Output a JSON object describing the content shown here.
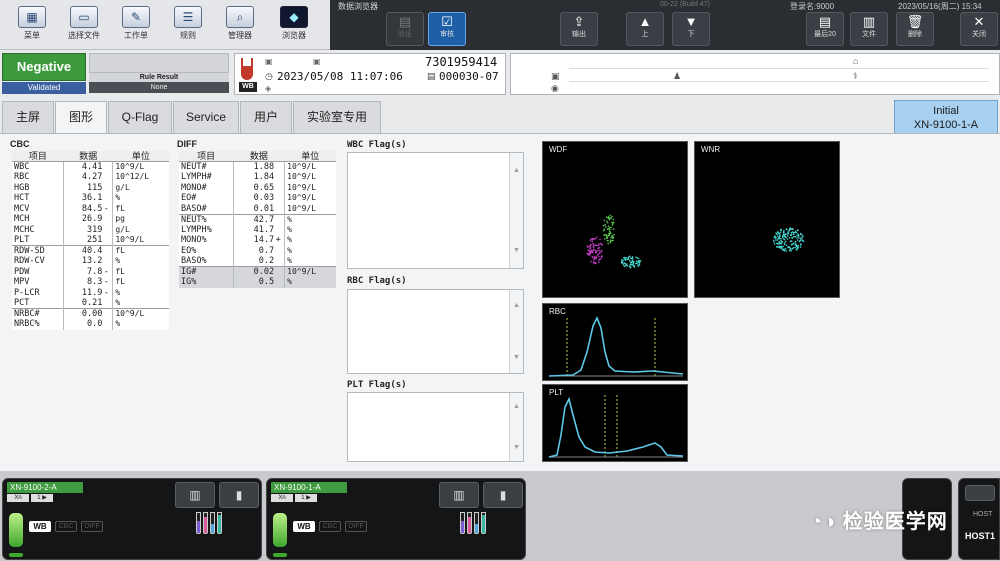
{
  "toolbar": {
    "left_buttons": [
      {
        "label": "菜单",
        "icon": "menu-icon"
      },
      {
        "label": "选择文件",
        "icon": "folder-icon"
      },
      {
        "label": "工作单",
        "icon": "worklist-icon"
      },
      {
        "label": "规则",
        "icon": "rules-icon"
      },
      {
        "label": "管理器",
        "icon": "manager-icon"
      },
      {
        "label": "浏览器",
        "icon": "browser-icon"
      }
    ],
    "window_title": "数据浏览器",
    "build": "00-22 (Build 47)",
    "login": "登录名:9000",
    "datetime": "2023/05/16(周二) 15:34",
    "right_buttons": [
      {
        "label": "验证",
        "icon": "validate-icon",
        "glyph": "▤"
      },
      {
        "label": "审核",
        "icon": "check-icon",
        "glyph": "☑"
      },
      {
        "label": "输出",
        "icon": "output-icon",
        "glyph": "⇪"
      },
      {
        "label": "上",
        "icon": "arrow-up-icon",
        "glyph": "▲"
      },
      {
        "label": "下",
        "icon": "arrow-down-icon",
        "glyph": "▼"
      },
      {
        "label": "最后20",
        "icon": "last20-icon",
        "glyph": "▤"
      },
      {
        "label": "文件",
        "icon": "file-icon",
        "glyph": "▥"
      },
      {
        "label": "删除",
        "icon": "delete-icon",
        "glyph": "🗑"
      },
      {
        "label": "关闭",
        "icon": "close-icon",
        "glyph": "✕"
      }
    ]
  },
  "status": {
    "result": "Negative",
    "validated": "Validated",
    "rule_result_label": "Rule Result",
    "rule_result_value": "None"
  },
  "sample": {
    "tube_label": "WB",
    "sample_no": "7301959414",
    "datetime": "2023/05/08 11:07:06",
    "seq": "000030-07"
  },
  "tabs": [
    {
      "label": "主屏",
      "active": false
    },
    {
      "label": "图形",
      "active": true
    },
    {
      "label": "Q-Flag",
      "active": false
    },
    {
      "label": "Service",
      "active": false
    },
    {
      "label": "用户",
      "active": false
    },
    {
      "label": "实验室专用",
      "active": false
    }
  ],
  "initial": {
    "line1": "Initial",
    "line2": "XN-9100-1-A"
  },
  "cbc": {
    "title": "CBC",
    "headers": [
      "项目",
      "数据",
      "单位"
    ],
    "rows": [
      {
        "item": "WBC",
        "value": "4.41",
        "flag": "",
        "unit": "10^9/L",
        "group": false
      },
      {
        "item": "RBC",
        "value": "4.27",
        "flag": "",
        "unit": "10^12/L",
        "group": false
      },
      {
        "item": "HGB",
        "value": "115",
        "flag": "",
        "unit": "g/L",
        "group": false
      },
      {
        "item": "HCT",
        "value": "36.1",
        "flag": "",
        "unit": "%",
        "group": false
      },
      {
        "item": "MCV",
        "value": "84.5",
        "flag": "-",
        "unit": "fL",
        "group": false
      },
      {
        "item": "MCH",
        "value": "26.9",
        "flag": "",
        "unit": "pg",
        "group": false
      },
      {
        "item": "MCHC",
        "value": "319",
        "flag": "",
        "unit": "g/L",
        "group": false
      },
      {
        "item": "PLT",
        "value": "251",
        "flag": "",
        "unit": "10^9/L",
        "group": false
      },
      {
        "item": "RDW-SD",
        "value": "40.4",
        "flag": "",
        "unit": "fL",
        "group": true
      },
      {
        "item": "RDW-CV",
        "value": "13.2",
        "flag": "",
        "unit": "%",
        "group": false
      },
      {
        "item": "PDW",
        "value": "7.8",
        "flag": "-",
        "unit": "fL",
        "group": false
      },
      {
        "item": "MPV",
        "value": "8.3",
        "flag": "-",
        "unit": "fL",
        "group": false
      },
      {
        "item": "P-LCR",
        "value": "11.9",
        "flag": "-",
        "unit": "%",
        "group": false
      },
      {
        "item": "PCT",
        "value": "0.21",
        "flag": "",
        "unit": "%",
        "group": false
      },
      {
        "item": "NRBC#",
        "value": "0.00",
        "flag": "",
        "unit": "10^9/L",
        "group": true
      },
      {
        "item": "NRBC%",
        "value": "0.0",
        "flag": "",
        "unit": "%",
        "group": false
      }
    ]
  },
  "diff": {
    "title": "DIFF",
    "headers": [
      "项目",
      "数据",
      "单位"
    ],
    "rows": [
      {
        "item": "NEUT#",
        "value": "1.88",
        "flag": "",
        "unit": "10^9/L",
        "group": false,
        "shade": false
      },
      {
        "item": "LYMPH#",
        "value": "1.84",
        "flag": "",
        "unit": "10^9/L",
        "group": false,
        "shade": false
      },
      {
        "item": "MONO#",
        "value": "0.65",
        "flag": "",
        "unit": "10^9/L",
        "group": false,
        "shade": false
      },
      {
        "item": "EO#",
        "value": "0.03",
        "flag": "",
        "unit": "10^9/L",
        "group": false,
        "shade": false
      },
      {
        "item": "BASO#",
        "value": "0.01",
        "flag": "",
        "unit": "10^9/L",
        "group": false,
        "shade": false
      },
      {
        "item": "NEUT%",
        "value": "42.7",
        "flag": "",
        "unit": "%",
        "group": true,
        "shade": false
      },
      {
        "item": "LYMPH%",
        "value": "41.7",
        "flag": "",
        "unit": "%",
        "group": false,
        "shade": false
      },
      {
        "item": "MONO%",
        "value": "14.7",
        "flag": "+",
        "unit": "%",
        "group": false,
        "shade": false
      },
      {
        "item": "EO%",
        "value": "0.7",
        "flag": "",
        "unit": "%",
        "group": false,
        "shade": false
      },
      {
        "item": "BASO%",
        "value": "0.2",
        "flag": "",
        "unit": "%",
        "group": false,
        "shade": false
      },
      {
        "item": "IG#",
        "value": "0.02",
        "flag": "",
        "unit": "10^9/L",
        "group": true,
        "shade": true
      },
      {
        "item": "IG%",
        "value": "0.5",
        "flag": "",
        "unit": "%",
        "group": false,
        "shade": true
      }
    ]
  },
  "flags": {
    "wbc": "WBC Flag(s)",
    "rbc": "RBC Flag(s)",
    "plt": "PLT Flag(s)"
  },
  "plots": {
    "wdf": "WDF",
    "wnr": "WNR",
    "rbc": "RBC",
    "plt": "PLT",
    "colors": {
      "lymph": "#c43cc4",
      "neut": "#55c24a",
      "mono": "#46d6d0",
      "curve": "#5ec8e8",
      "marker": "#b9d24a"
    }
  },
  "analyzers": [
    {
      "name": "XN-9100-2-A",
      "sub1": "Xn",
      "sub2": "1 ▶",
      "wb": "WB",
      "cbc": "CBC",
      "diff": "DIFF"
    },
    {
      "name": "XN-9100-1-A",
      "sub1": "Xn",
      "sub2": "1 ▶",
      "wb": "WB",
      "cbc": "CBC",
      "diff": "DIFF"
    }
  ],
  "host": {
    "label": "HOST",
    "label2": "HOST1"
  },
  "watermark": "检验医学网"
}
